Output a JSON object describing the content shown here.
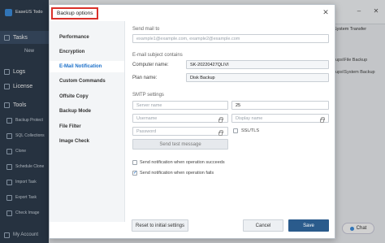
{
  "app": {
    "name": "EaseUS Todo",
    "nav": {
      "tasks": "Tasks",
      "new": "New",
      "logs": "Logs",
      "license": "License",
      "tools": "Tools",
      "tools_items": [
        "Backup Protect",
        "SQL Collections",
        "Clone",
        "Schedule Clone",
        "Import Task",
        "Export Task",
        "Check Image"
      ],
      "account": "My Account"
    },
    "system_transfer": "System Transfer",
    "paths": [
      "ups\\File Backup",
      "ups\\System Backup"
    ],
    "chat": "Chat"
  },
  "dialog": {
    "title": "Backup options",
    "menu": [
      "Performance",
      "Encryption",
      "E-Mail Notification",
      "Custom Commands",
      "Offsite Copy",
      "Backup Mode",
      "File Filter",
      "Image Check"
    ],
    "active_menu": "E-Mail Notification",
    "send_mail_to": {
      "label": "Send mail to",
      "placeholder": "example1@example.com, example2@example.com"
    },
    "subject": {
      "label": "E-mail subject contains",
      "computer_name_label": "Computer name:",
      "computer_name_value": "SK-20220427QLIVI",
      "plan_name_label": "Plan name:",
      "plan_name_value": "Disk Backup"
    },
    "smtp": {
      "label": "SMTP settings",
      "server_placeholder": "Server name",
      "port_value": "25",
      "username_placeholder": "Username",
      "display_name_placeholder": "Display name",
      "password_placeholder": "Password",
      "ssl_label": "SSL/TLS",
      "test_button": "Send test message"
    },
    "notify_success_label": "Send notification when operation succeeds",
    "notify_success_checked": false,
    "notify_fail_label": "Send notification when operation fails",
    "notify_fail_checked": true,
    "reset_button": "Reset to initial settings",
    "cancel_button": "Cancel",
    "save_button": "Save"
  },
  "colors": {
    "highlight_border": "#d9302a",
    "accent": "#1a6fc9",
    "primary_button": "#2a5b8c",
    "sidebar": "#2f3e4f"
  }
}
